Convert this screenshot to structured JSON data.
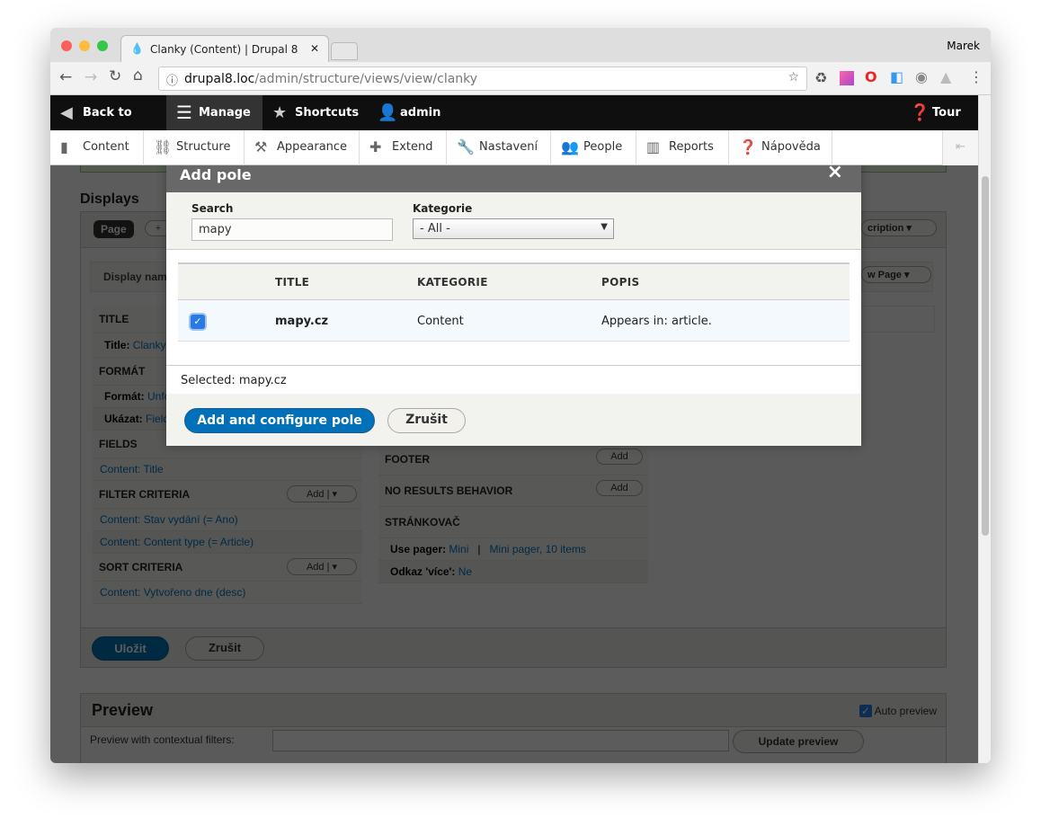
{
  "browser": {
    "tab_title": "Clanky (Content) | Drupal 8",
    "user": "Marek",
    "url_host": "drupal8.loc",
    "url_path": "/admin/structure/views/view/clanky"
  },
  "toolbar": {
    "back": "Back to site",
    "manage": "Manage",
    "shortcuts": "Shortcuts",
    "user": "admin",
    "tour": "Tour"
  },
  "tray": [
    "Content",
    "Structure",
    "Appearance",
    "Extend",
    "Nastavení",
    "People",
    "Reports",
    "Nápověda"
  ],
  "page": {
    "displays": "Displays",
    "page_tab": "Page",
    "display_name": "Display nam",
    "edit_description": "cription",
    "view_page": "w Page",
    "title_h": "TITLE",
    "title_label": "Title:",
    "title_val": "Clanky",
    "format_h": "FORMÁT",
    "format_label": "Formát:",
    "format_val": "Unformatted list",
    "show_label": "Ukázat:",
    "show_val": "Fields",
    "fields_h": "FIELDS",
    "fields_item": "Content: Title",
    "filter_h": "FILTER CRITERIA",
    "filter_items": [
      "Content: Stav vydání (= Ano)",
      "Content: Content type (= Article)"
    ],
    "sort_h": "SORT CRITERIA",
    "sort_items": [
      "Content: Vytvořeno dne (desc)"
    ],
    "add": "Add",
    "footer_h": "FOOTER",
    "noresults_h": "NO RESULTS BEHAVIOR",
    "pager_h": "STRÁNKOVAČ",
    "pager_label": "Use pager:",
    "pager_val": "Mini",
    "pager_sep": "|",
    "pager_val2": "Mini pager, 10 items",
    "more_label": "Odkaz 'více':",
    "more_val": "Ne",
    "save": "Uložit",
    "cancel": "Zrušit",
    "preview": "Preview",
    "auto_preview": "Auto preview",
    "contextual": "Preview with contextual filters:",
    "update_preview": "Update preview"
  },
  "dialog": {
    "title": "Add pole",
    "close": "×",
    "search_label": "Search",
    "search_value": "mapy",
    "category_label": "Kategorie",
    "category_value": "- All -",
    "columns": [
      "TITLE",
      "KATEGORIE",
      "POPIS"
    ],
    "rows": [
      {
        "checked": true,
        "title": "mapy.cz",
        "category": "Content",
        "description": "Appears in: article."
      }
    ],
    "selected": "Selected: mapy.cz",
    "submit": "Add and configure pole",
    "cancel": "Zrušit"
  },
  "colors": {
    "primary": "#0071b8",
    "toolbar": "#0f0f0f",
    "link": "#0074bd"
  }
}
